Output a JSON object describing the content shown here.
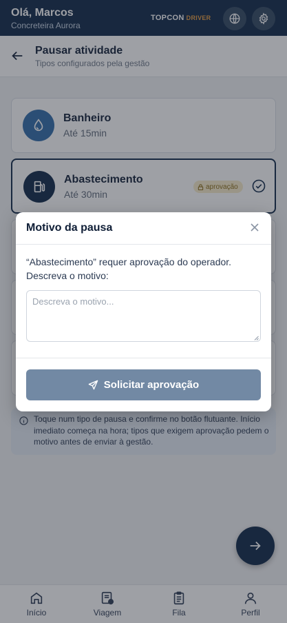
{
  "header": {
    "greeting": "Olá, Marcos",
    "company": "Concreteira Aurora",
    "brand_main": "TOPCON",
    "brand_sub": "DRIVER",
    "language_icon": "globe-icon",
    "settings_icon": "gear-icon"
  },
  "subheader": {
    "title": "Pausar atividade",
    "subtitle": "Tipos configurados pela gestão"
  },
  "pause_types": [
    {
      "name": "Banheiro",
      "duration": "Até 15min",
      "icon": "water-drop-icon",
      "selected": false
    },
    {
      "name": "Abastecimento",
      "duration": "Até 30min",
      "icon": "fuel-pump-icon",
      "selected": true,
      "badge": "aprovação"
    }
  ],
  "info_text": "Toque num tipo de pausa e confirme no botão flutuante. Início imediato começa na hora; tipos que exigem aprovação pedem o motivo antes de enviar à gestão.",
  "modal": {
    "title": "Motivo da pausa",
    "message": "“Abastecimento” requer aprovação do operador. Descreva o motivo:",
    "placeholder": "Descreva o motivo...",
    "value": "",
    "submit_label": "Solicitar aprovação"
  },
  "nav": {
    "tabs": [
      {
        "label": "Início",
        "icon": "home-icon"
      },
      {
        "label": "Viagem",
        "icon": "truck-ticket-icon"
      },
      {
        "label": "Fila",
        "icon": "clipboard-list-icon"
      },
      {
        "label": "Perfil",
        "icon": "user-icon"
      }
    ]
  },
  "colors": {
    "primary": "#0b2545",
    "accent": "#e59a3c",
    "card_icon": "#2f6aa8",
    "badge_bg": "#f7ecc8",
    "submit_disabled": "#7289a4"
  }
}
